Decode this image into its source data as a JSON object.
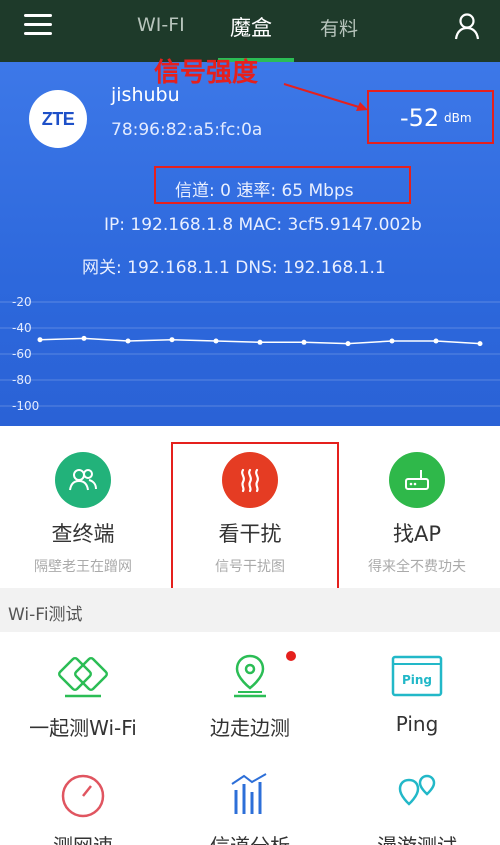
{
  "nav": {
    "tabs": [
      {
        "label": "WI-FI"
      },
      {
        "label": "魔盒"
      },
      {
        "label": "有料"
      }
    ],
    "active_tab": "魔盒"
  },
  "network": {
    "logo_text": "ZTE",
    "ssid": "jishubu",
    "bssid": "78:96:82:a5:fc:0a",
    "signal_value": "-52",
    "signal_unit": "dBm",
    "channel_rate": "信道: 0  速率: 65 Mbps",
    "ip_mac": "IP: 192.168.1.8  MAC: 3cf5.9147.002b",
    "gateway_dns": "网关: 192.168.1.1  DNS: 192.168.1.1"
  },
  "annotation": {
    "signal_label": "信号强度"
  },
  "chart_data": {
    "type": "line",
    "y_ticks": [
      "-20",
      "-40",
      "-60",
      "-80",
      "-100"
    ],
    "ylim": [
      -100,
      -20
    ],
    "values": [
      -49,
      -48,
      -50,
      -49,
      -50,
      -51,
      -51,
      -52,
      -50,
      -50,
      -52
    ],
    "grid": true
  },
  "tools": [
    {
      "title": "查终端",
      "subtitle": "隔壁老王在蹭网",
      "color": "#22b27a"
    },
    {
      "title": "看干扰",
      "subtitle": "信号干扰图",
      "color": "#e53c23"
    },
    {
      "title": "找AP",
      "subtitle": "得来全不费功夫",
      "color": "#2fb84a"
    }
  ],
  "section": {
    "title": "Wi-Fi测试"
  },
  "tests": [
    {
      "title": "一起测Wi-Fi"
    },
    {
      "title": "边走边测"
    },
    {
      "title": "Ping",
      "icon_text": "Ping"
    },
    {
      "title": "测网速"
    },
    {
      "title": "信道分析"
    },
    {
      "title": "漫游测试"
    }
  ],
  "colors": {
    "accent_green": "#2bbd55",
    "panel_blue": "#3070e0",
    "annotation_red": "#e5201d"
  }
}
